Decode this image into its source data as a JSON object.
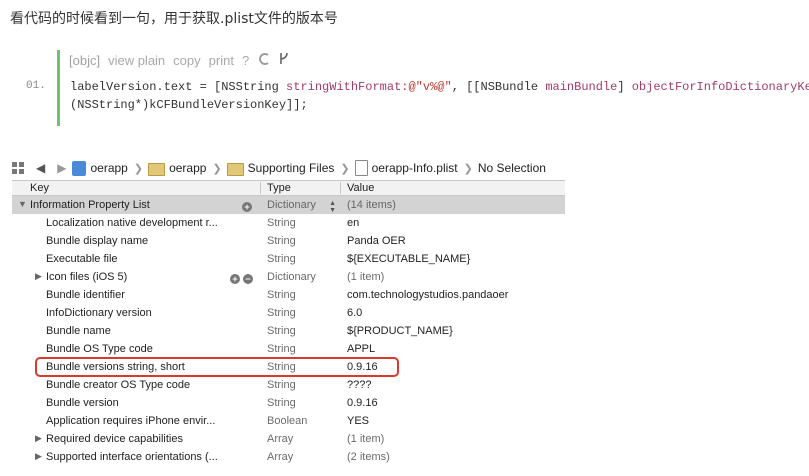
{
  "intro": "看代码的时候看到一句，用于获取.plist文件的版本号",
  "code": {
    "toolbar": {
      "lang": "[objc]",
      "view_plain": "view plain",
      "copy": "copy",
      "print": "print",
      "help": "?"
    },
    "line_number": "01.",
    "line1_a": "labelVersion.text = [NSString ",
    "line1_b": "stringWithFormat:",
    "line1_c": "@\"v%@\"",
    "line1_d": ", [[NSBundle ",
    "line1_e": "mainBundle",
    "line1_f": "] ",
    "line1_g": "objectForInfoDictionaryKey:",
    "line2": "(NSString*)kCFBundleVersionKey]];"
  },
  "jumpbar": {
    "items": [
      "oerapp",
      "oerapp",
      "Supporting Files",
      "oerapp-Info.plist",
      "No Selection"
    ]
  },
  "plist": {
    "headers": {
      "key": "Key",
      "type": "Type",
      "value": "Value"
    },
    "rows": [
      {
        "key": "Information Property List",
        "type": "Dictionary",
        "value": "(14 items)"
      },
      {
        "key": "Localization native development r...",
        "type": "String",
        "value": "en"
      },
      {
        "key": "Bundle display name",
        "type": "String",
        "value": "Panda OER"
      },
      {
        "key": "Executable file",
        "type": "String",
        "value": "${EXECUTABLE_NAME}"
      },
      {
        "key": "Icon files (iOS 5)",
        "type": "Dictionary",
        "value": "(1 item)"
      },
      {
        "key": "Bundle identifier",
        "type": "String",
        "value": "com.technologystudios.pandaoer"
      },
      {
        "key": "InfoDictionary version",
        "type": "String",
        "value": "6.0"
      },
      {
        "key": "Bundle name",
        "type": "String",
        "value": "${PRODUCT_NAME}"
      },
      {
        "key": "Bundle OS Type code",
        "type": "String",
        "value": "APPL"
      },
      {
        "key": "Bundle versions string, short",
        "type": "String",
        "value": "0.9.16"
      },
      {
        "key": "Bundle creator OS Type code",
        "type": "String",
        "value": "????"
      },
      {
        "key": "Bundle version",
        "type": "String",
        "value": "0.9.16"
      },
      {
        "key": "Application requires iPhone envir...",
        "type": "Boolean",
        "value": "YES"
      },
      {
        "key": "Required device capabilities",
        "type": "Array",
        "value": "(1 item)"
      },
      {
        "key": "Supported interface orientations (...",
        "type": "Array",
        "value": "(2 items)"
      }
    ]
  },
  "colors": {
    "highlight": "#d93a2e",
    "code_bar": "#6ec36e"
  }
}
